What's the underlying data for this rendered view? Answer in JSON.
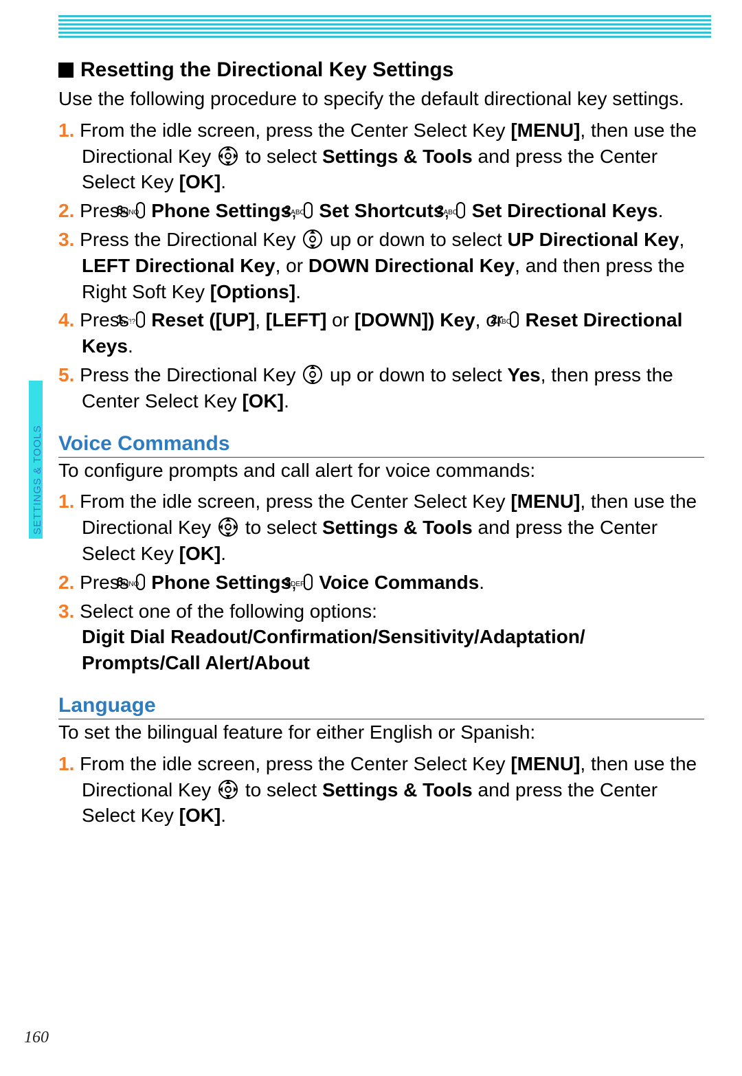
{
  "sidebar": {
    "label": "SETTINGS & TOOLS"
  },
  "page_number": "160",
  "keys": {
    "k6": "6",
    "k6s": "MNO",
    "k2": "2",
    "k2s": "ABC",
    "k3": "3",
    "k3s": "DEF",
    "k1": "1.",
    "k1s": "-'!?"
  },
  "section1": {
    "title": "Resetting the Directional Key Settings",
    "lead": "Use the following procedure to specify the default directional key settings.",
    "s1a": "From the idle screen, press the Center Select Key ",
    "s1b": "[MENU]",
    "s1c": ", then use the Directional Key ",
    "s1d": " to select ",
    "s1e": "Settings & Tools",
    "s1f": " and press the Center Select Key ",
    "s1g": "[OK]",
    "s1h": ".",
    "s2a": "Press ",
    "s2b": " Phone Settings",
    "s2c": ", ",
    "s2d": " Set Shortcuts",
    "s2e": ", ",
    "s2f": " Set Directional Keys",
    "s2g": ".",
    "s3a": "Press the Directional Key ",
    "s3b": " up or down to select ",
    "s3c": "UP Directional Key",
    "s3d": ", ",
    "s3e": "LEFT Directional Key",
    "s3f": ", or ",
    "s3g": "DOWN Directional Key",
    "s3h": ", and then press the Right Soft Key ",
    "s3i": "[Options]",
    "s3j": ".",
    "s4a": "Press ",
    "s4b": " Reset ([UP]",
    "s4c": ", ",
    "s4d": "[LEFT]",
    "s4e": " or ",
    "s4f": "[DOWN]) Key",
    "s4g": ", or ",
    "s4h": " Reset Directional Keys",
    "s4i": ".",
    "s5a": "Press the Directional Key ",
    "s5b": " up or down to select ",
    "s5c": "Yes",
    "s5d": ", then press the Center Select Key ",
    "s5e": "[OK]",
    "s5f": "."
  },
  "section2": {
    "title": "Voice Commands",
    "lead": "To configure prompts and call alert for voice commands:",
    "s1a": "From the idle screen, press the Center Select Key ",
    "s1b": "[MENU]",
    "s1c": ", then use the Directional Key ",
    "s1d": " to select ",
    "s1e": "Settings & Tools",
    "s1f": " and press the Center Select Key ",
    "s1g": "[OK]",
    "s1h": ".",
    "s2a": "Press ",
    "s2b": " Phone Settings",
    "s2c": ", ",
    "s2d": " Voice Commands",
    "s2e": ".",
    "s3a": "Select one of the following options:",
    "s3b": "Digit Dial Readout/Confirmation/Sensitivity/Adaptation/ Prompts/Call Alert/About"
  },
  "section3": {
    "title": "Language",
    "lead": "To set the bilingual feature for either English or Spanish:",
    "s1a": "From the idle screen, press the Center Select Key ",
    "s1b": "[MENU]",
    "s1c": ", then use the Directional Key ",
    "s1d": " to select ",
    "s1e": "Settings & Tools",
    "s1f": " and press the Center Select Key ",
    "s1g": "[OK]",
    "s1h": "."
  },
  "nums": {
    "n1": "1.",
    "n2": "2.",
    "n3": "3.",
    "n4": "4.",
    "n5": "5."
  }
}
